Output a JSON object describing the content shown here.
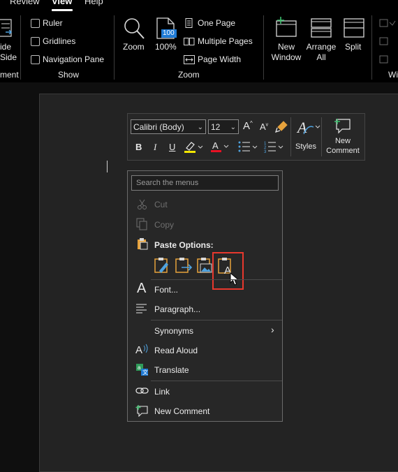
{
  "ribbon": {
    "tabs": [
      "Review",
      "View",
      "Help"
    ],
    "active_tab": "View",
    "side_to_side_label": [
      "ide",
      "Side"
    ],
    "movement_group_label": "ment",
    "show": {
      "items": [
        "Ruler",
        "Gridlines",
        "Navigation Pane"
      ],
      "group_label": "Show"
    },
    "zoom": {
      "zoom_label": "Zoom",
      "percent_label": "100%",
      "percent_badge": "100",
      "one_page": "One Page",
      "multiple_pages": "Multiple Pages",
      "page_width": "Page Width",
      "group_label": "Zoom"
    },
    "window": {
      "new_window": [
        "New",
        "Window"
      ],
      "arrange_all": [
        "Arrange",
        "All"
      ],
      "split": "Split",
      "group_label": "Wi"
    }
  },
  "mini_toolbar": {
    "font_name": "Calibri (Body)",
    "font_size": "12",
    "styles_label": "Styles",
    "new_comment": [
      "New",
      "Comment"
    ],
    "highlight_color": "#f3e600",
    "font_color": "#e81123"
  },
  "context_menu": {
    "search_placeholder": "Search the menus",
    "cut": "Cut",
    "copy": "Copy",
    "paste_options": "Paste Options:",
    "font": "Font...",
    "paragraph": "Paragraph...",
    "synonyms": "Synonyms",
    "read_aloud": "Read Aloud",
    "translate": "Translate",
    "link": "Link",
    "new_comment": "New Comment"
  },
  "accent_color": "#e8382d"
}
